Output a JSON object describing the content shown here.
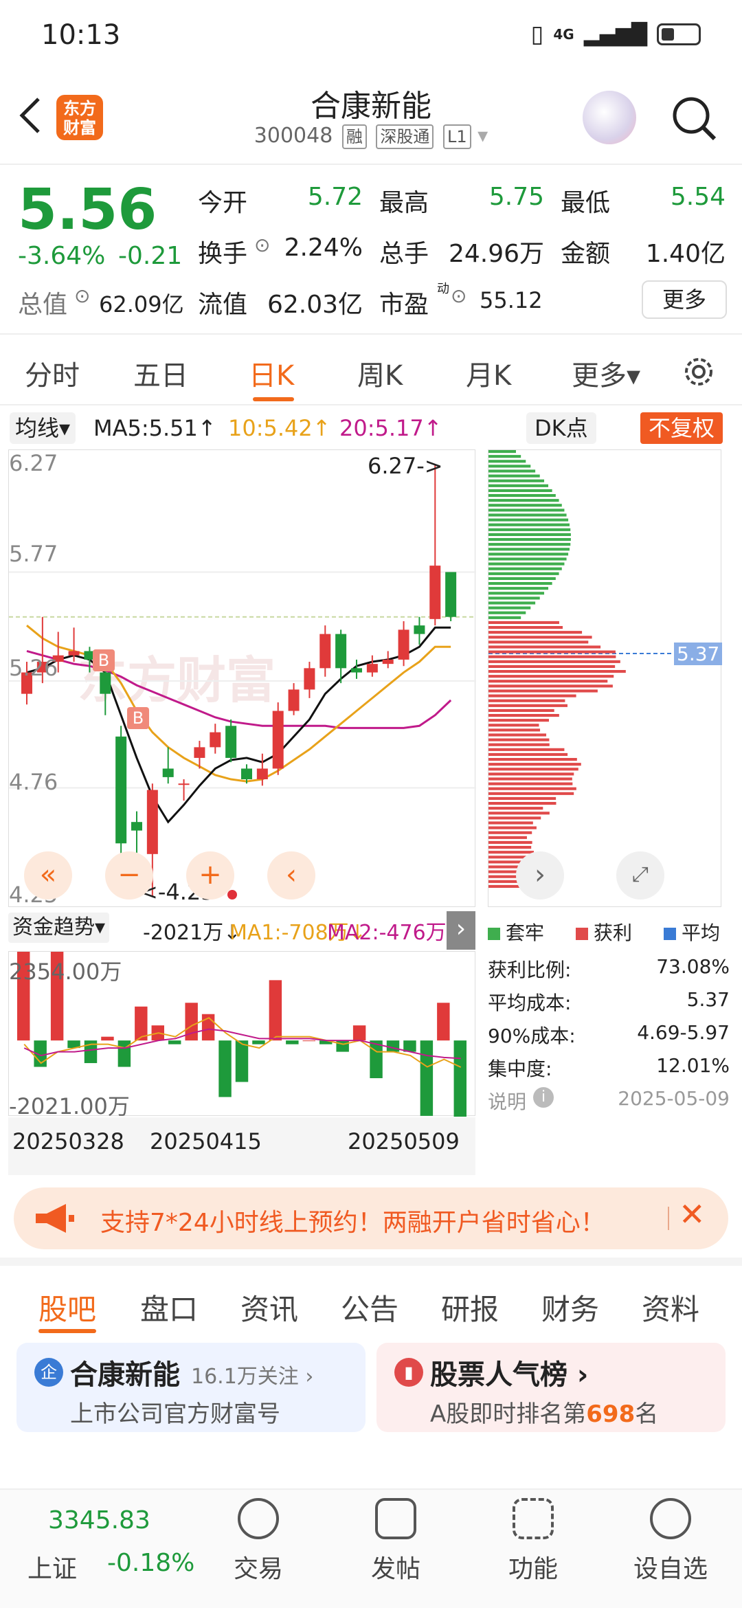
{
  "status_bar": {
    "time": "10:13",
    "network": "4G"
  },
  "header": {
    "logo_text": "东方\n财富",
    "title": "合康新能",
    "code": "300048",
    "tags": [
      "融",
      "深股通",
      "L1"
    ]
  },
  "quote": {
    "price": "5.56",
    "change_pct": "-3.64%",
    "change": "-0.21",
    "open_label": "今开",
    "open": "5.72",
    "high_label": "最高",
    "high": "5.75",
    "low_label": "最低",
    "low": "5.54",
    "turnover_label": "换手",
    "turnover": "2.24%",
    "volume_label": "总手",
    "volume": "24.96万",
    "amount_label": "金额",
    "amount": "1.40亿",
    "mktcap_label": "总值",
    "mktcap": "62.09亿",
    "float_label": "流值",
    "float": "62.03亿",
    "pe_label": "市盈",
    "pe_sup": "动",
    "pe": "55.12",
    "more": "更多"
  },
  "chart_tabs": [
    {
      "label": "分时"
    },
    {
      "label": "五日"
    },
    {
      "label": "日K"
    },
    {
      "label": "周K"
    },
    {
      "label": "月K"
    },
    {
      "label": "更多▾"
    }
  ],
  "ma_row": {
    "selector": "均线▾",
    "ma5": "MA5:5.51↑",
    "ma10": "10:5.42↑",
    "ma20": "20:5.17↑",
    "dk": "DK点",
    "fuquan": "不复权"
  },
  "kline": {
    "y_labels": [
      "6.27",
      "5.77",
      "5.26",
      "4.76",
      "4.25"
    ],
    "high_note": "6.27->",
    "low_note": "<-4.25",
    "watermark": "东方财富",
    "markers": [
      "B",
      "B"
    ]
  },
  "chart_data": {
    "type": "candlestick",
    "ylim": [
      4.25,
      6.27
    ],
    "candles": [
      [
        5.2,
        5.3,
        5.35,
        5.15
      ],
      [
        5.3,
        5.35,
        5.56,
        5.25
      ],
      [
        5.35,
        5.38,
        5.49,
        5.3
      ],
      [
        5.38,
        5.4,
        5.51,
        5.35
      ],
      [
        5.4,
        5.36,
        5.42,
        5.3
      ],
      [
        5.3,
        5.2,
        5.32,
        5.1
      ],
      [
        5.0,
        4.5,
        5.05,
        4.4
      ],
      [
        4.6,
        4.56,
        4.65,
        4.45
      ],
      [
        4.45,
        4.75,
        4.78,
        4.25
      ],
      [
        4.85,
        4.81,
        4.95,
        4.78
      ],
      [
        4.78,
        4.78,
        4.8,
        4.7
      ],
      [
        4.9,
        4.95,
        4.98,
        4.85
      ],
      [
        4.95,
        5.02,
        5.06,
        4.92
      ],
      [
        5.05,
        4.9,
        5.08,
        4.88
      ],
      [
        4.85,
        4.8,
        4.87,
        4.78
      ],
      [
        4.8,
        4.85,
        4.92,
        4.77
      ],
      [
        4.85,
        5.12,
        5.16,
        4.82
      ],
      [
        5.12,
        5.22,
        5.25,
        5.1
      ],
      [
        5.22,
        5.32,
        5.35,
        5.18
      ],
      [
        5.32,
        5.48,
        5.52,
        5.28
      ],
      [
        5.48,
        5.32,
        5.5,
        5.25
      ],
      [
        5.32,
        5.3,
        5.36,
        5.27
      ],
      [
        5.3,
        5.34,
        5.38,
        5.28
      ],
      [
        5.34,
        5.36,
        5.4,
        5.32
      ],
      [
        5.36,
        5.5,
        5.54,
        5.33
      ],
      [
        5.52,
        5.48,
        5.56,
        5.43
      ],
      [
        5.55,
        5.8,
        6.27,
        5.52
      ],
      [
        5.77,
        5.56,
        5.75,
        5.54
      ]
    ],
    "ma5": [
      5.3,
      5.32,
      5.36,
      5.38,
      5.36,
      5.3,
      5.1,
      4.9,
      4.72,
      4.6,
      4.68,
      4.77,
      4.85,
      4.89,
      4.9,
      4.88,
      4.92,
      5.0,
      5.08,
      5.2,
      5.27,
      5.33,
      5.35,
      5.36,
      5.38,
      5.42,
      5.51,
      5.51
    ],
    "ma10": [
      5.52,
      5.46,
      5.42,
      5.4,
      5.38,
      5.35,
      5.25,
      5.12,
      5.02,
      4.95,
      4.9,
      4.86,
      4.82,
      4.8,
      4.79,
      4.8,
      4.84,
      4.89,
      4.94,
      5.0,
      5.06,
      5.12,
      5.18,
      5.24,
      5.3,
      5.35,
      5.42,
      5.42
    ],
    "ma20": [
      5.4,
      5.38,
      5.36,
      5.34,
      5.33,
      5.31,
      5.28,
      5.24,
      5.21,
      5.18,
      5.15,
      5.12,
      5.09,
      5.07,
      5.06,
      5.05,
      5.05,
      5.05,
      5.05,
      5.05,
      5.04,
      5.04,
      5.04,
      5.04,
      5.04,
      5.05,
      5.1,
      5.17
    ]
  },
  "fund_row": {
    "selector": "资金趋势▾",
    "value": "-2021万↓",
    "ma1": "MA1:-708万↓",
    "ma2": "MA2:-476万↓"
  },
  "fund_chart": {
    "y_top": "2354.00万",
    "y_bottom": "-2021.00万",
    "values": [
      2354,
      -700,
      2354,
      -200,
      -600,
      100,
      -700,
      900,
      400,
      -100,
      1000,
      700,
      -1500,
      -1100,
      -100,
      1600,
      -100,
      0,
      -100,
      -300,
      400,
      -1000,
      -300,
      -300,
      -2000,
      1000,
      -2021
    ],
    "ma1": [
      -100,
      -600,
      -300,
      -200,
      -100,
      -100,
      -200,
      100,
      200,
      100,
      400,
      600,
      200,
      -100,
      -200,
      100,
      100,
      100,
      0,
      -100,
      0,
      -300,
      -300,
      -400,
      -700,
      -500,
      -708
    ],
    "ma2": [
      -200,
      -400,
      -300,
      -300,
      -250,
      -200,
      -200,
      -100,
      0,
      50,
      200,
      300,
      250,
      150,
      50,
      50,
      50,
      50,
      0,
      0,
      0,
      -100,
      -200,
      -300,
      -400,
      -450,
      -476
    ]
  },
  "dates": [
    "20250328",
    "20250415",
    "20250509"
  ],
  "dist_legend": [
    {
      "label": "套牢",
      "color": "#3fae4e"
    },
    {
      "label": "获利",
      "color": "#e04a4a"
    },
    {
      "label": "平均",
      "color": "#3a7bd5"
    }
  ],
  "dist_price_tag": "5.37",
  "stats": [
    {
      "label": "获利比例:",
      "value": "73.08%"
    },
    {
      "label": "平均成本:",
      "value": "5.37"
    },
    {
      "label": "90%成本:",
      "value": "4.69-5.97"
    },
    {
      "label": "集中度:",
      "value": "12.01%"
    }
  ],
  "explain": {
    "label": "说明",
    "date": "2025-05-09"
  },
  "banner": {
    "text": "支持7*24小时线上预约！两融开户省时省心！"
  },
  "bottom_tabs": [
    {
      "label": "股吧"
    },
    {
      "label": "盘口"
    },
    {
      "label": "资讯"
    },
    {
      "label": "公告"
    },
    {
      "label": "研报"
    },
    {
      "label": "财务"
    },
    {
      "label": "资料"
    }
  ],
  "cards": {
    "company": {
      "icon": "企",
      "title": "合康新能",
      "followers": "16.1万关注 ›",
      "desc": "上市公司官方财富号"
    },
    "ranking": {
      "title": "股票人气榜 ›",
      "desc_pre": "A股即时排名第",
      "rank": "698",
      "desc_post": "名"
    }
  },
  "bottom_nav": {
    "index_value": "3345.83",
    "index_name": "上证",
    "index_change": "-0.18%",
    "items": [
      {
        "label": "交易"
      },
      {
        "label": "发帖"
      },
      {
        "label": "功能"
      },
      {
        "label": "设自选"
      }
    ]
  },
  "colors": {
    "up": "#e03a3a",
    "down": "#1e9a3b",
    "accent": "#f26a1b"
  }
}
